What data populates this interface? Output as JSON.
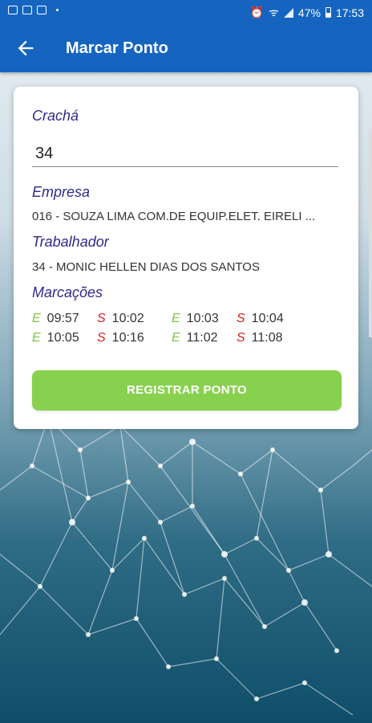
{
  "status": {
    "battery": "47%",
    "time": "17:53"
  },
  "header": {
    "title": "Marcar Ponto"
  },
  "form": {
    "cracha_label": "Crachá",
    "cracha_value": "34",
    "empresa_label": "Empresa",
    "empresa_value": "016 - SOUZA LIMA COM.DE EQUIP.ELET. EIRELI ...",
    "trabalhador_label": "Trabalhador",
    "trabalhador_value": "34 - MONIC HELLEN DIAS DOS SANTOS",
    "marcacoes_label": "Marcações",
    "marcacoes": [
      {
        "type": "E",
        "time": "09:57"
      },
      {
        "type": "S",
        "time": "10:02"
      },
      {
        "type": "E",
        "time": "10:03"
      },
      {
        "type": "S",
        "time": "10:04"
      },
      {
        "type": "E",
        "time": "10:05"
      },
      {
        "type": "S",
        "time": "10:16"
      },
      {
        "type": "E",
        "time": "11:02"
      },
      {
        "type": "S",
        "time": "11:08"
      }
    ],
    "button_label": "REGISTRAR PONTO"
  },
  "colors": {
    "primary": "#1565c0",
    "accent_button": "#88d14f",
    "label_text": "#2f2a8a",
    "entrada": "#7cc744",
    "saida": "#d62020"
  },
  "icons": {
    "back": "arrow-left-icon"
  }
}
